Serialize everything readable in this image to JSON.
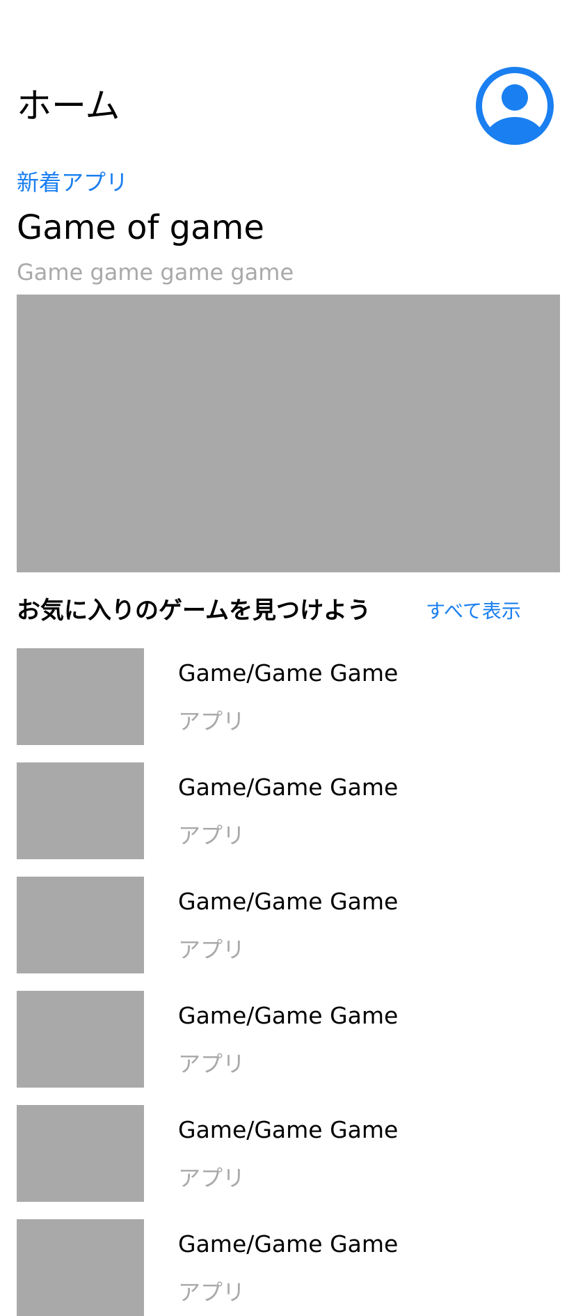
{
  "header": {
    "title": "ホーム",
    "avatar_icon": "person-circle-icon",
    "accent_color": "#1a7ff0"
  },
  "featured": {
    "label": "新着アプリ",
    "title": "Game of game",
    "subtitle": "Game game game game"
  },
  "section": {
    "title": "お気に入りのゲームを見つけよう",
    "see_all_label": "すべて表示"
  },
  "apps": [
    {
      "name": "Game/Game Game",
      "category": "アプリ"
    },
    {
      "name": "Game/Game Game",
      "category": "アプリ"
    },
    {
      "name": "Game/Game Game",
      "category": "アプリ"
    },
    {
      "name": "Game/Game Game",
      "category": "アプリ"
    },
    {
      "name": "Game/Game Game",
      "category": "アプリ"
    },
    {
      "name": "Game/Game Game",
      "category": "アプリ"
    }
  ]
}
